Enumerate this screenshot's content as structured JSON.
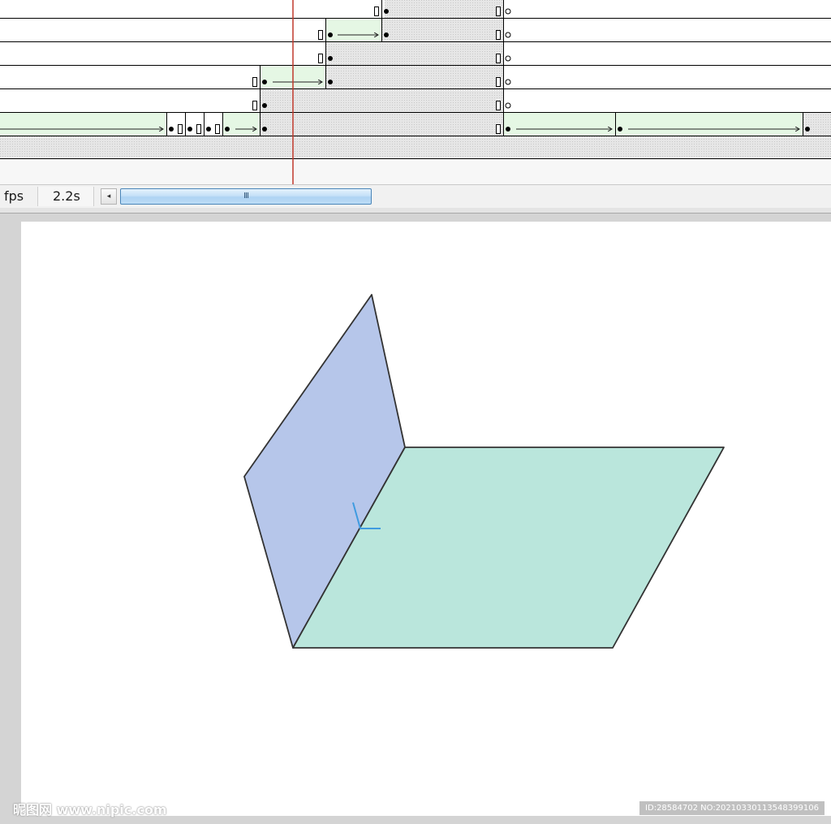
{
  "timeline": {
    "fps_label": "fps",
    "duration": "2.2s",
    "scroll_left_glyph": "◂",
    "scroll_thumb_glyph": "III",
    "colors": {
      "tween_fill": "#e5f7e4",
      "empty_fill": "#e4e4e4",
      "playhead": "#c0392b",
      "row_line": "#000000"
    }
  },
  "stage": {
    "colors": {
      "vertical_plane": "#b6c6ea",
      "horizontal_plane": "#bae6dc",
      "edge": "#333333",
      "angle_mark": "#3f9be0"
    }
  },
  "watermark": {
    "left": "昵图网 www.nipic.com",
    "right": "ID:28584702 NO:20210330113548399106"
  }
}
